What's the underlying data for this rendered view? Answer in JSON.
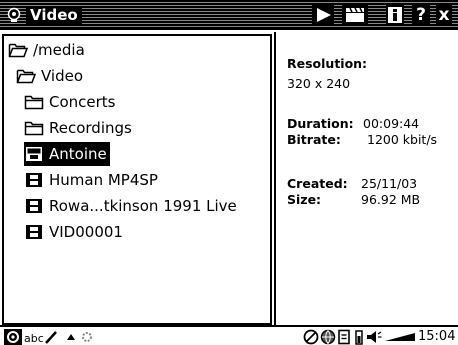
{
  "titlebar": {
    "title": "Video",
    "help_label": "?",
    "close_label": "x"
  },
  "file_list": {
    "items": [
      {
        "label": "/media",
        "icon": "folder-open-icon",
        "indent": 0
      },
      {
        "label": "Video",
        "icon": "folder-open-icon",
        "indent": 1
      },
      {
        "label": "Concerts",
        "icon": "folder-icon",
        "indent": 2
      },
      {
        "label": "Recordings",
        "icon": "folder-icon",
        "indent": 2
      },
      {
        "label": "Antoine",
        "icon": "film-icon",
        "indent": 2,
        "selected": true
      },
      {
        "label": "Human MP4SP",
        "icon": "film-icon",
        "indent": 2
      },
      {
        "label": "Rowa...tkinson 1991 Live",
        "icon": "film-icon",
        "indent": 2
      },
      {
        "label": "VID00001",
        "icon": "film-icon",
        "indent": 2
      }
    ]
  },
  "info": {
    "resolution_label": "Resolution:",
    "resolution_value": "320 x 240",
    "duration_label": "Duration:",
    "duration_value": "00:09:44",
    "bitrate_label": "Bitrate:",
    "bitrate_value": "1200 kbit/s",
    "created_label": "Created:",
    "created_value": "25/11/03",
    "size_label": "Size:",
    "size_value": "96.92 MB"
  },
  "statusbar": {
    "input_mode": "abc",
    "clock": "15:04"
  },
  "colors": {
    "foreground": "#000000",
    "background": "#ffffff",
    "selection": "#000000"
  }
}
